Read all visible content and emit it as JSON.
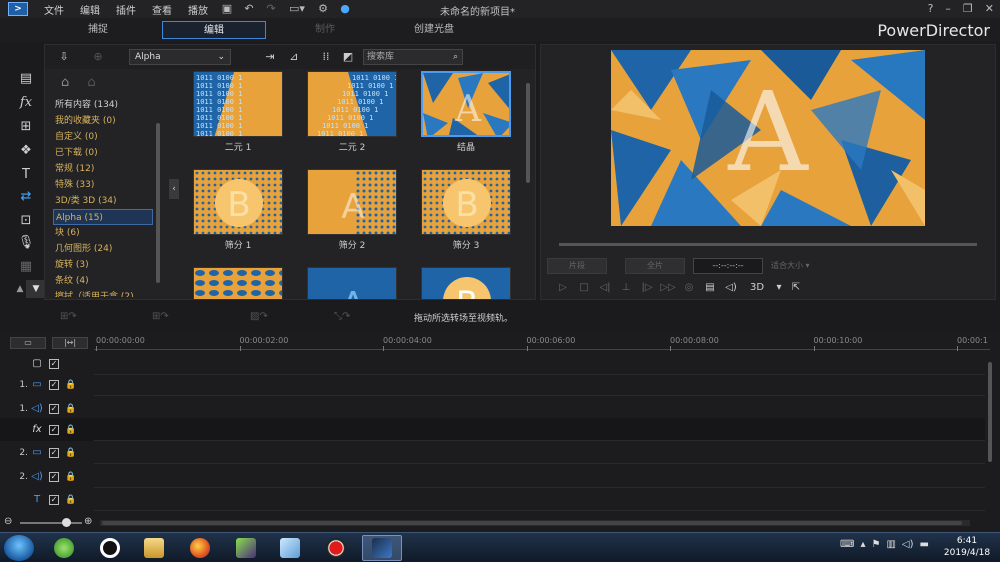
{
  "titlebar": {
    "menus": [
      "文件",
      "编辑",
      "插件",
      "查看",
      "播放"
    ],
    "document_title": "未命名的新项目*",
    "help": "?"
  },
  "modes": {
    "capture": "捕捉",
    "edit": "编辑",
    "produce": "制作",
    "create_disc": "创建光盘",
    "brand": "PowerDirector"
  },
  "library": {
    "dropdown_value": "Alpha",
    "search_placeholder": "搜索库",
    "categories": [
      "所有内容 (134)",
      "我的收藏夹  (0)",
      "自定义  (0)",
      "已下载  (0)",
      "常规  (12)",
      "特殊  (33)",
      "3D/类 3D  (34)",
      "Alpha  (15)",
      "块  (6)",
      "几何图形  (24)",
      "旋转  (3)",
      "条纹  (4)",
      "擦拭（适用于盒  (2)"
    ],
    "selected_category_index": 7,
    "tiles": [
      {
        "label": "二元 1",
        "style": "binary1"
      },
      {
        "label": "二元 2",
        "style": "binary2"
      },
      {
        "label": "结晶",
        "style": "crystal"
      },
      {
        "label": "筛分 1",
        "style": "sieve1"
      },
      {
        "label": "筛分 2",
        "style": "sieve2"
      },
      {
        "label": "筛分 3",
        "style": "sieve3"
      },
      {
        "label": "",
        "style": "row3a"
      },
      {
        "label": "",
        "style": "row3b"
      },
      {
        "label": "",
        "style": "row3c"
      }
    ],
    "selected_tile_index": 2
  },
  "preview": {
    "btn_clip": "片段",
    "btn_movie": "全片",
    "timecode": "--:--:--:--",
    "fit_label": "适合大小",
    "three_d": "3D"
  },
  "edit_toolbar": {
    "hint": "拖动所选转场至视频轨。"
  },
  "timeline": {
    "ruler_labels": [
      "00:00:00:00",
      "00:00:02:00",
      "00:00:04:00",
      "00:00:06:00",
      "00:00:08:00",
      "00:00:10:00",
      "00:00:1"
    ],
    "tracks": [
      {
        "num": "",
        "icon": "frame-icon",
        "glyph": "▢"
      },
      {
        "num": "1.",
        "icon": "video-track-icon",
        "glyph": "▭"
      },
      {
        "num": "1.",
        "icon": "audio-track-icon",
        "glyph": "◁)"
      },
      {
        "num": "",
        "icon": "fx-track-icon",
        "glyph": "fx"
      },
      {
        "num": "2.",
        "icon": "video-track-icon",
        "glyph": "▭"
      },
      {
        "num": "2.",
        "icon": "audio-track-icon",
        "glyph": "◁)"
      },
      {
        "num": "",
        "icon": "title-track-icon",
        "glyph": "T"
      }
    ]
  },
  "taskbar": {
    "time": "6:41",
    "date": "2019/4/18",
    "apps": [
      "ie-app",
      "qq-app",
      "explorer-app",
      "firefox-app",
      "media-app",
      "notes-app",
      "recorder-app",
      "powerdirector-app"
    ],
    "active_app": "powerdirector-app"
  },
  "colors": {
    "accent": "#3f87d6",
    "orange": "#e8a23c",
    "blue": "#1f64a6"
  }
}
